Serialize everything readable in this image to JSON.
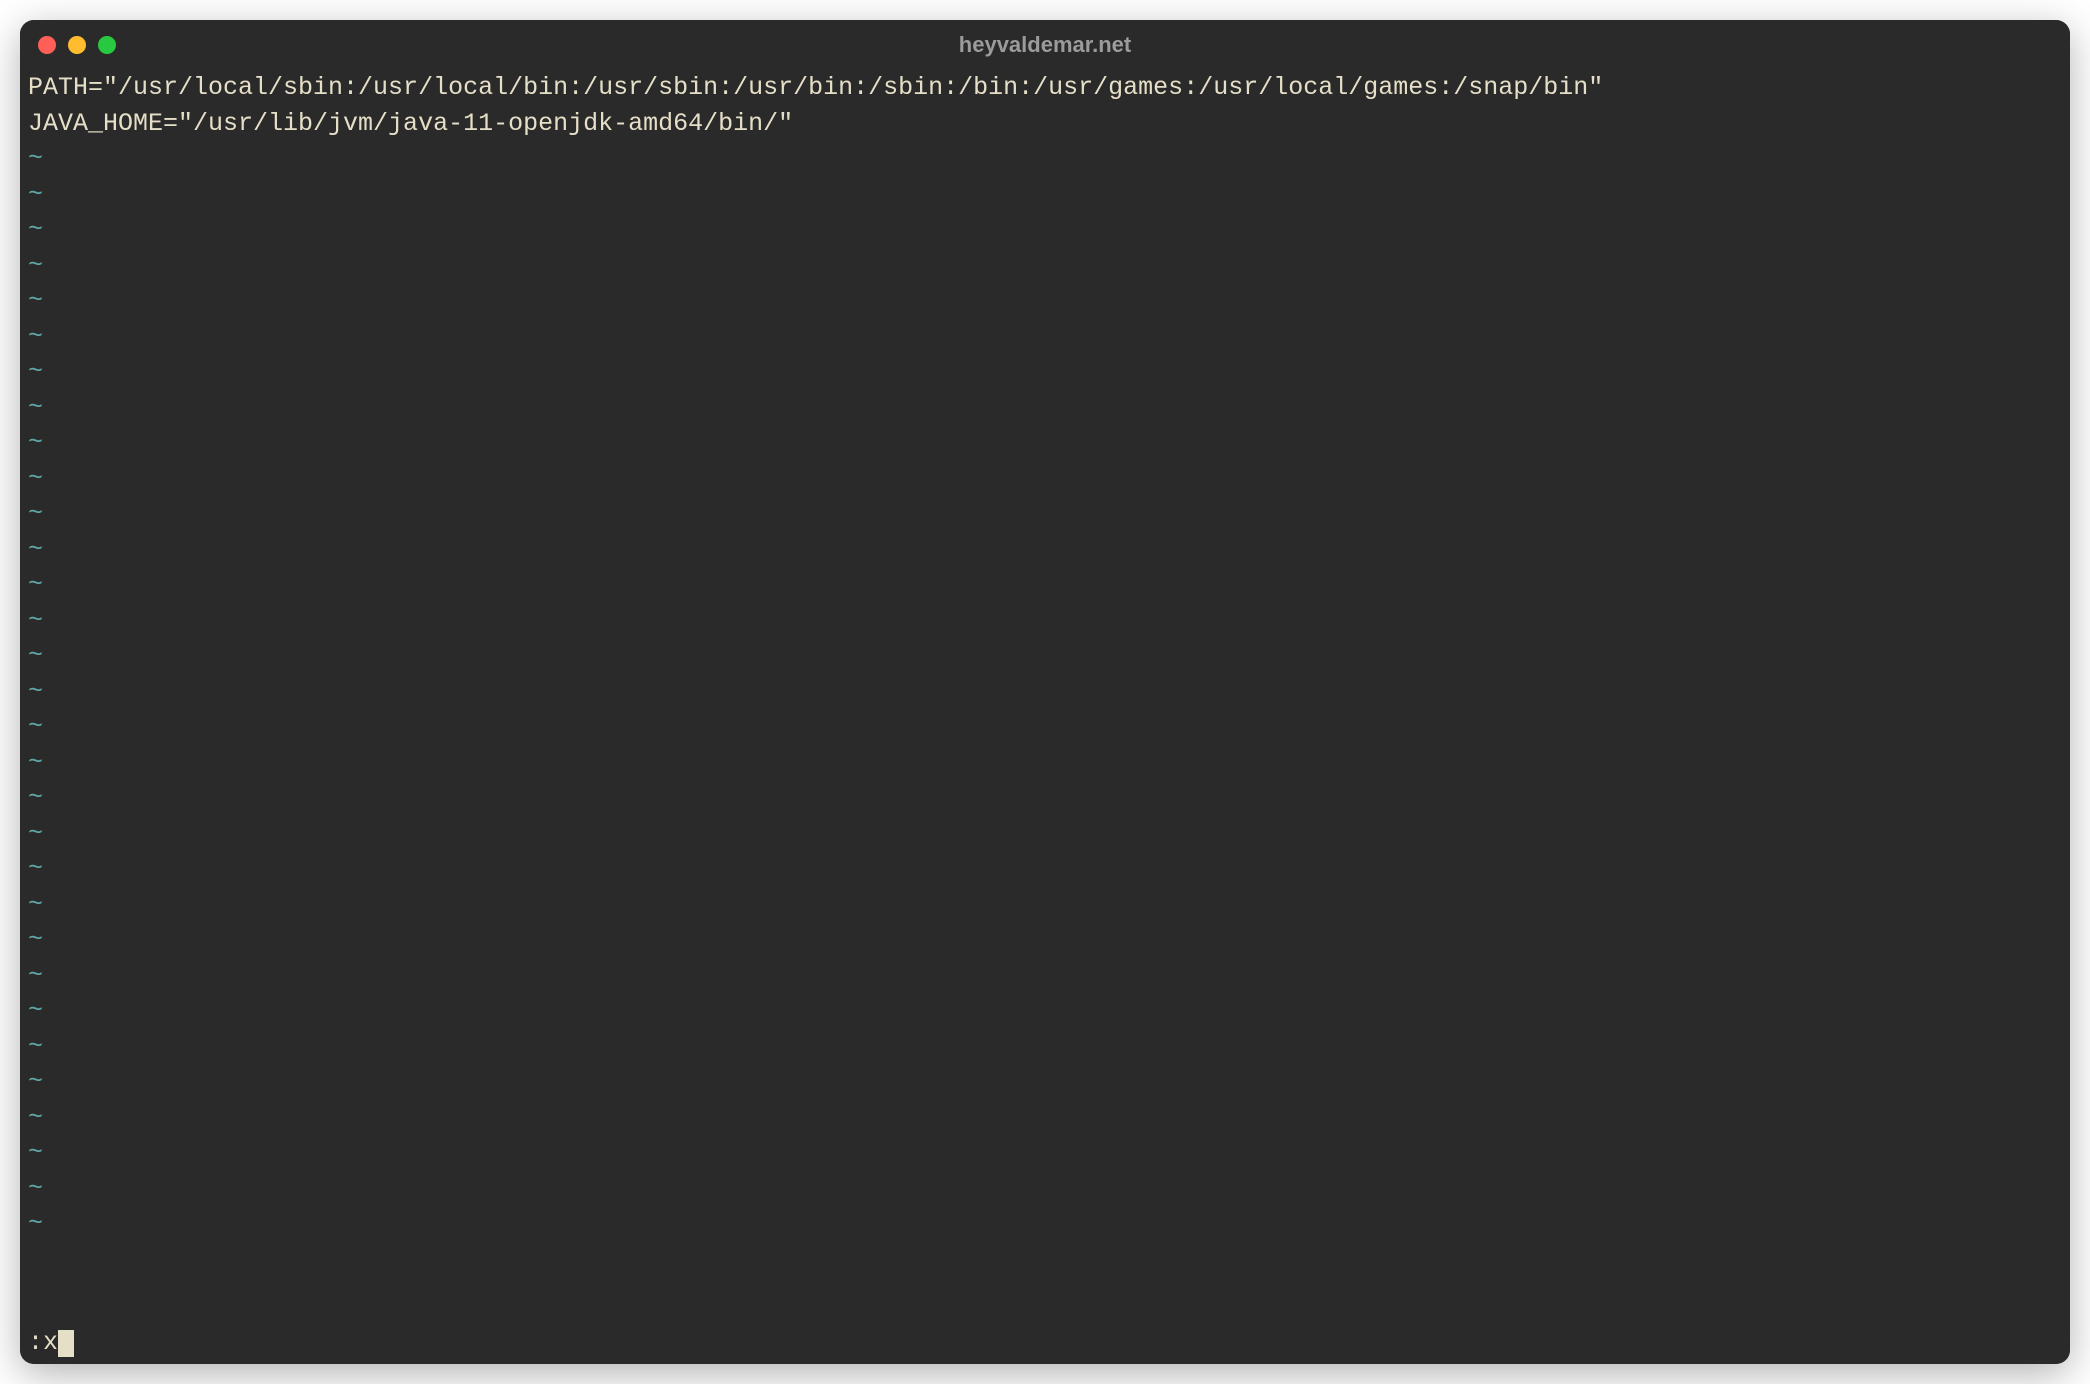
{
  "window": {
    "title": "heyvaldemar.net"
  },
  "editor": {
    "content_lines": [
      "PATH=\"/usr/local/sbin:/usr/local/bin:/usr/sbin:/usr/bin:/sbin:/bin:/usr/games:/usr/local/games:/snap/bin\"",
      "JAVA_HOME=\"/usr/lib/jvm/java-11-openjdk-amd64/bin/\""
    ],
    "tilde": "~",
    "tilde_count": 31,
    "command_prompt": ":",
    "command_text": "x"
  },
  "colors": {
    "bg": "#2a2a2a",
    "text": "#e6dfc8",
    "tilde": "#5fa8a8",
    "title": "#9b9b9b",
    "close": "#ff5f57",
    "min": "#febc2e",
    "max": "#28c840"
  }
}
